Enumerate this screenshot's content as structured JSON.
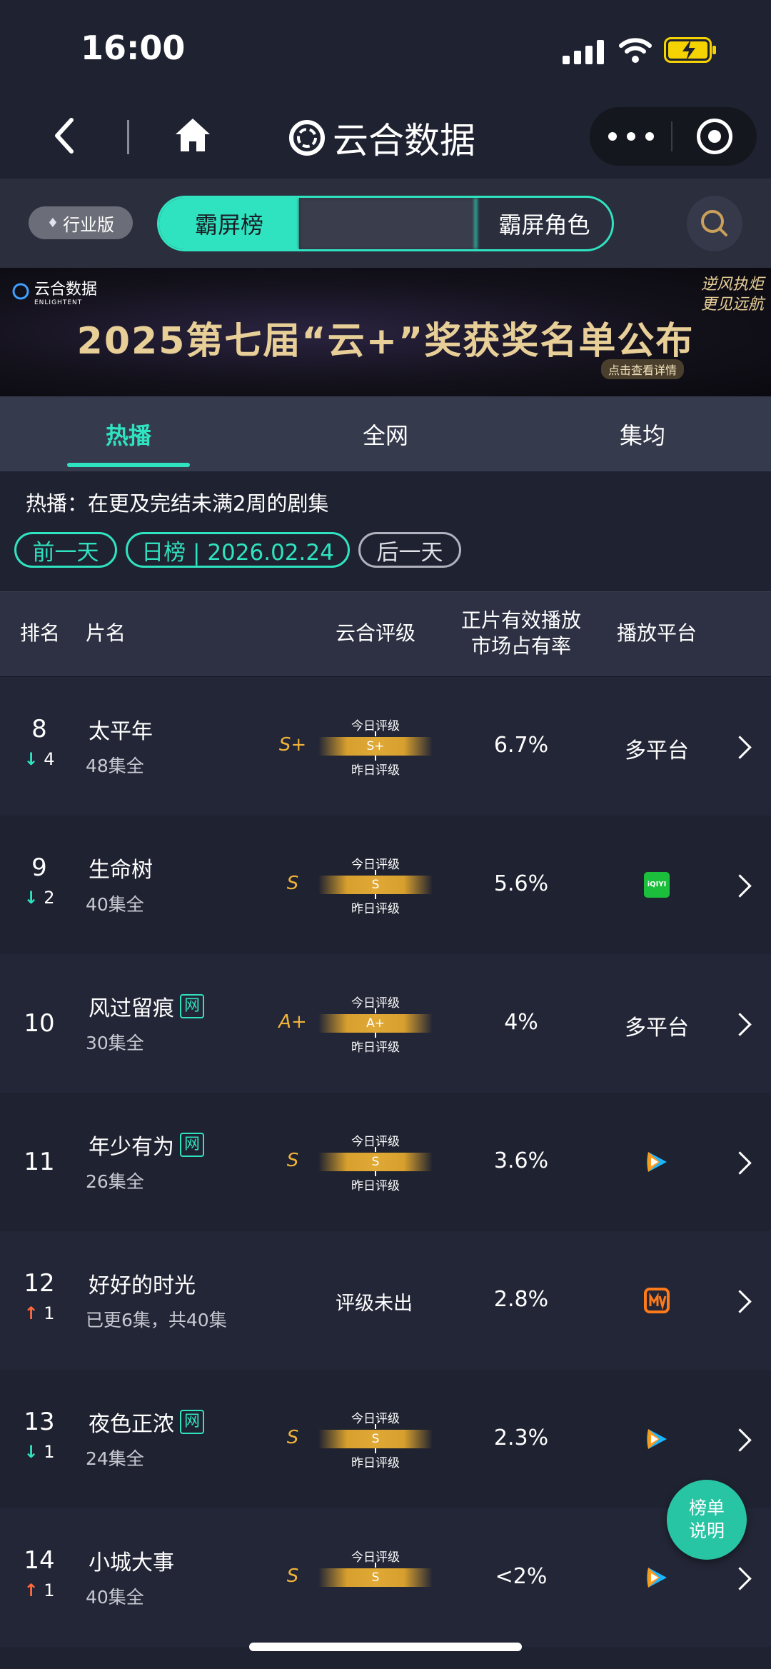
{
  "status_bar": {
    "time": "16:00"
  },
  "nav": {
    "title": "云合数据"
  },
  "subbar": {
    "edition_label": "行业版",
    "segments": [
      "霸屏榜",
      "",
      "霸屏角色"
    ]
  },
  "banner": {
    "brand": "云合数据",
    "brand_en": "ENLIGHTENT",
    "title": "2025第七届“云+”奖获奖名单公布",
    "cta": "点击查看详情",
    "slogan": "逆风执炬 更见远航"
  },
  "tabs": [
    "热播",
    "全网",
    "集均"
  ],
  "description": "热播：在更及完结未满2周的剧集",
  "date_controls": {
    "prev": "前一天",
    "current": "日榜 | 2026.02.24",
    "next": "后一天"
  },
  "table": {
    "headers": {
      "rank": "排名",
      "title": "片名",
      "rating": "云合评级",
      "share_line1": "正片有效播放",
      "share_line2": "市场占有率",
      "platform": "播放平台"
    },
    "rating_today_label": "今日评级",
    "rating_yesterday_label": "昨日评级",
    "rows": [
      {
        "rank": "8",
        "delta": "4",
        "trend": "down",
        "title": "太平年",
        "web": false,
        "episodes": "48集全",
        "grade": "S+",
        "grade_today": "S+",
        "show_yesterday": true,
        "share": "6.7%",
        "platform": "多平台",
        "platform_icon": ""
      },
      {
        "rank": "9",
        "delta": "2",
        "trend": "down",
        "title": "生命树",
        "web": false,
        "episodes": "40集全",
        "grade": "S",
        "grade_today": "S",
        "show_yesterday": true,
        "share": "5.6%",
        "platform": "",
        "platform_icon": "iqiyi-icon"
      },
      {
        "rank": "10",
        "delta": "",
        "trend": "",
        "title": "风过留痕",
        "web": true,
        "episodes": "30集全",
        "grade": "A+",
        "grade_today": "A+",
        "show_yesterday": true,
        "share": "4%",
        "platform": "多平台",
        "platform_icon": ""
      },
      {
        "rank": "11",
        "delta": "",
        "trend": "",
        "title": "年少有为",
        "web": true,
        "episodes": "26集全",
        "grade": "S",
        "grade_today": "S",
        "show_yesterday": true,
        "share": "3.6%",
        "platform": "",
        "platform_icon": "tencent-video-icon"
      },
      {
        "rank": "12",
        "delta": "1",
        "trend": "up",
        "title": "好好的时光",
        "web": false,
        "episodes": "已更6集，共40集",
        "grade": "",
        "grade_today": "",
        "show_yesterday": false,
        "no_rating": "评级未出",
        "share": "2.8%",
        "platform": "",
        "platform_icon": "mango-tv-icon"
      },
      {
        "rank": "13",
        "delta": "1",
        "trend": "down",
        "title": "夜色正浓",
        "web": true,
        "episodes": "24集全",
        "grade": "S",
        "grade_today": "S",
        "show_yesterday": true,
        "share": "2.3%",
        "platform": "",
        "platform_icon": "tencent-video-icon"
      },
      {
        "rank": "14",
        "delta": "1",
        "trend": "up",
        "title": "小城大事",
        "web": false,
        "episodes": "40集全",
        "grade": "S",
        "grade_today": "S",
        "show_yesterday": false,
        "share": "<2%",
        "platform": "",
        "platform_icon": "tencent-video-icon"
      }
    ],
    "web_badge": "网"
  },
  "float_button": {
    "line1": "榜单",
    "line2": "说明"
  },
  "colors": {
    "accent": "#30e3c0",
    "grade": "#f0b33a",
    "up": "#ff6a3d",
    "background": "#1f2230"
  }
}
